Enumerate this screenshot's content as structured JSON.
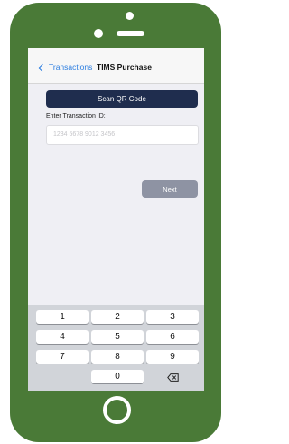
{
  "navbar": {
    "back_label": "Transactions",
    "title": "TIMS Purchase"
  },
  "form": {
    "scan_label": "Scan QR Code",
    "field_label": "Enter Transaction ID:",
    "placeholder": "1234 5678 9012 3456",
    "value": "",
    "next_label": "Next"
  },
  "keypad": {
    "row1": [
      "1",
      "2",
      "3"
    ],
    "row2": [
      "4",
      "5",
      "6"
    ],
    "row3": [
      "7",
      "8",
      "9"
    ],
    "zero": "0"
  },
  "icons": {
    "back": "chevron-left-icon",
    "delete": "backspace-icon",
    "home": "home-button"
  },
  "colors": {
    "phone_body": "#4a7a37",
    "accent": "#2b7de0",
    "scan_button": "#1f2d4e",
    "next_button": "#8e93a3"
  }
}
